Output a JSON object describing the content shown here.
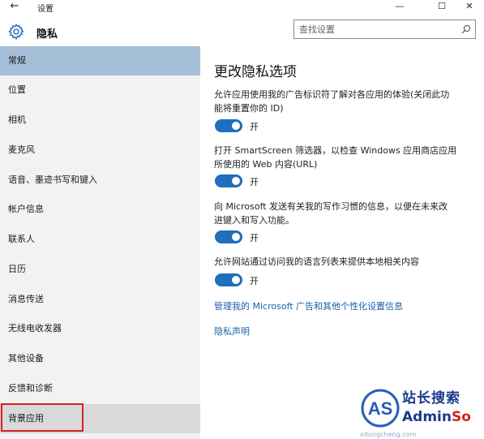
{
  "window": {
    "back_glyph": "←",
    "title": "设置",
    "minimize_glyph": "—",
    "maximize_glyph": "☐",
    "close_glyph": "✕"
  },
  "header": {
    "icon": "gear-icon",
    "title": "隐私",
    "search_placeholder": "查找设置",
    "search_value": "",
    "search_icon": "search-icon"
  },
  "sidebar": {
    "items": [
      {
        "label": "常规",
        "state": "selected"
      },
      {
        "label": "位置"
      },
      {
        "label": "相机"
      },
      {
        "label": "麦克风"
      },
      {
        "label": "语音、墨迹书写和键入"
      },
      {
        "label": "帐户信息"
      },
      {
        "label": "联系人"
      },
      {
        "label": "日历"
      },
      {
        "label": "消息传送"
      },
      {
        "label": "无线电收发器"
      },
      {
        "label": "其他设备"
      },
      {
        "label": "反馈和诊断"
      },
      {
        "label": "背景应用",
        "state": "hover"
      }
    ]
  },
  "main": {
    "heading": "更改隐私选项",
    "options": [
      {
        "line1": "允许应用使用我的广告标识符了解对各应用的体验(关闭此功",
        "line2": "能将重置你的 ID)",
        "toggle": "开",
        "on": true
      },
      {
        "line1": "打开 SmartScreen 筛选器，以检查 Windows 应用商店应用",
        "line2": "所使用的 Web 内容(URL)",
        "toggle": "开",
        "on": true
      },
      {
        "line1": "向 Microsoft 发送有关我的写作习惯的信息，以便在未来改",
        "line2": "进键入和写入功能。",
        "toggle": "开",
        "on": true
      },
      {
        "line1": "允许网站通过访问我的语言列表来提供本地相关内容",
        "line2": "",
        "toggle": "开",
        "on": true
      }
    ],
    "links": [
      "管理我的 Microsoft 广告和其他个性化设置信息",
      "隐私声明"
    ]
  },
  "watermark": {
    "logo_text": "AS",
    "title": "站长搜索",
    "brand_part1": "Admin",
    "brand_part2": "So",
    "url": "xitongcheng.com"
  },
  "colors": {
    "accent": "#1f6fbf",
    "selected_bg": "#a6bfd8",
    "sidebar_bg": "#f2f2f2",
    "link": "#1b5fa8",
    "highlight": "#d42020"
  }
}
